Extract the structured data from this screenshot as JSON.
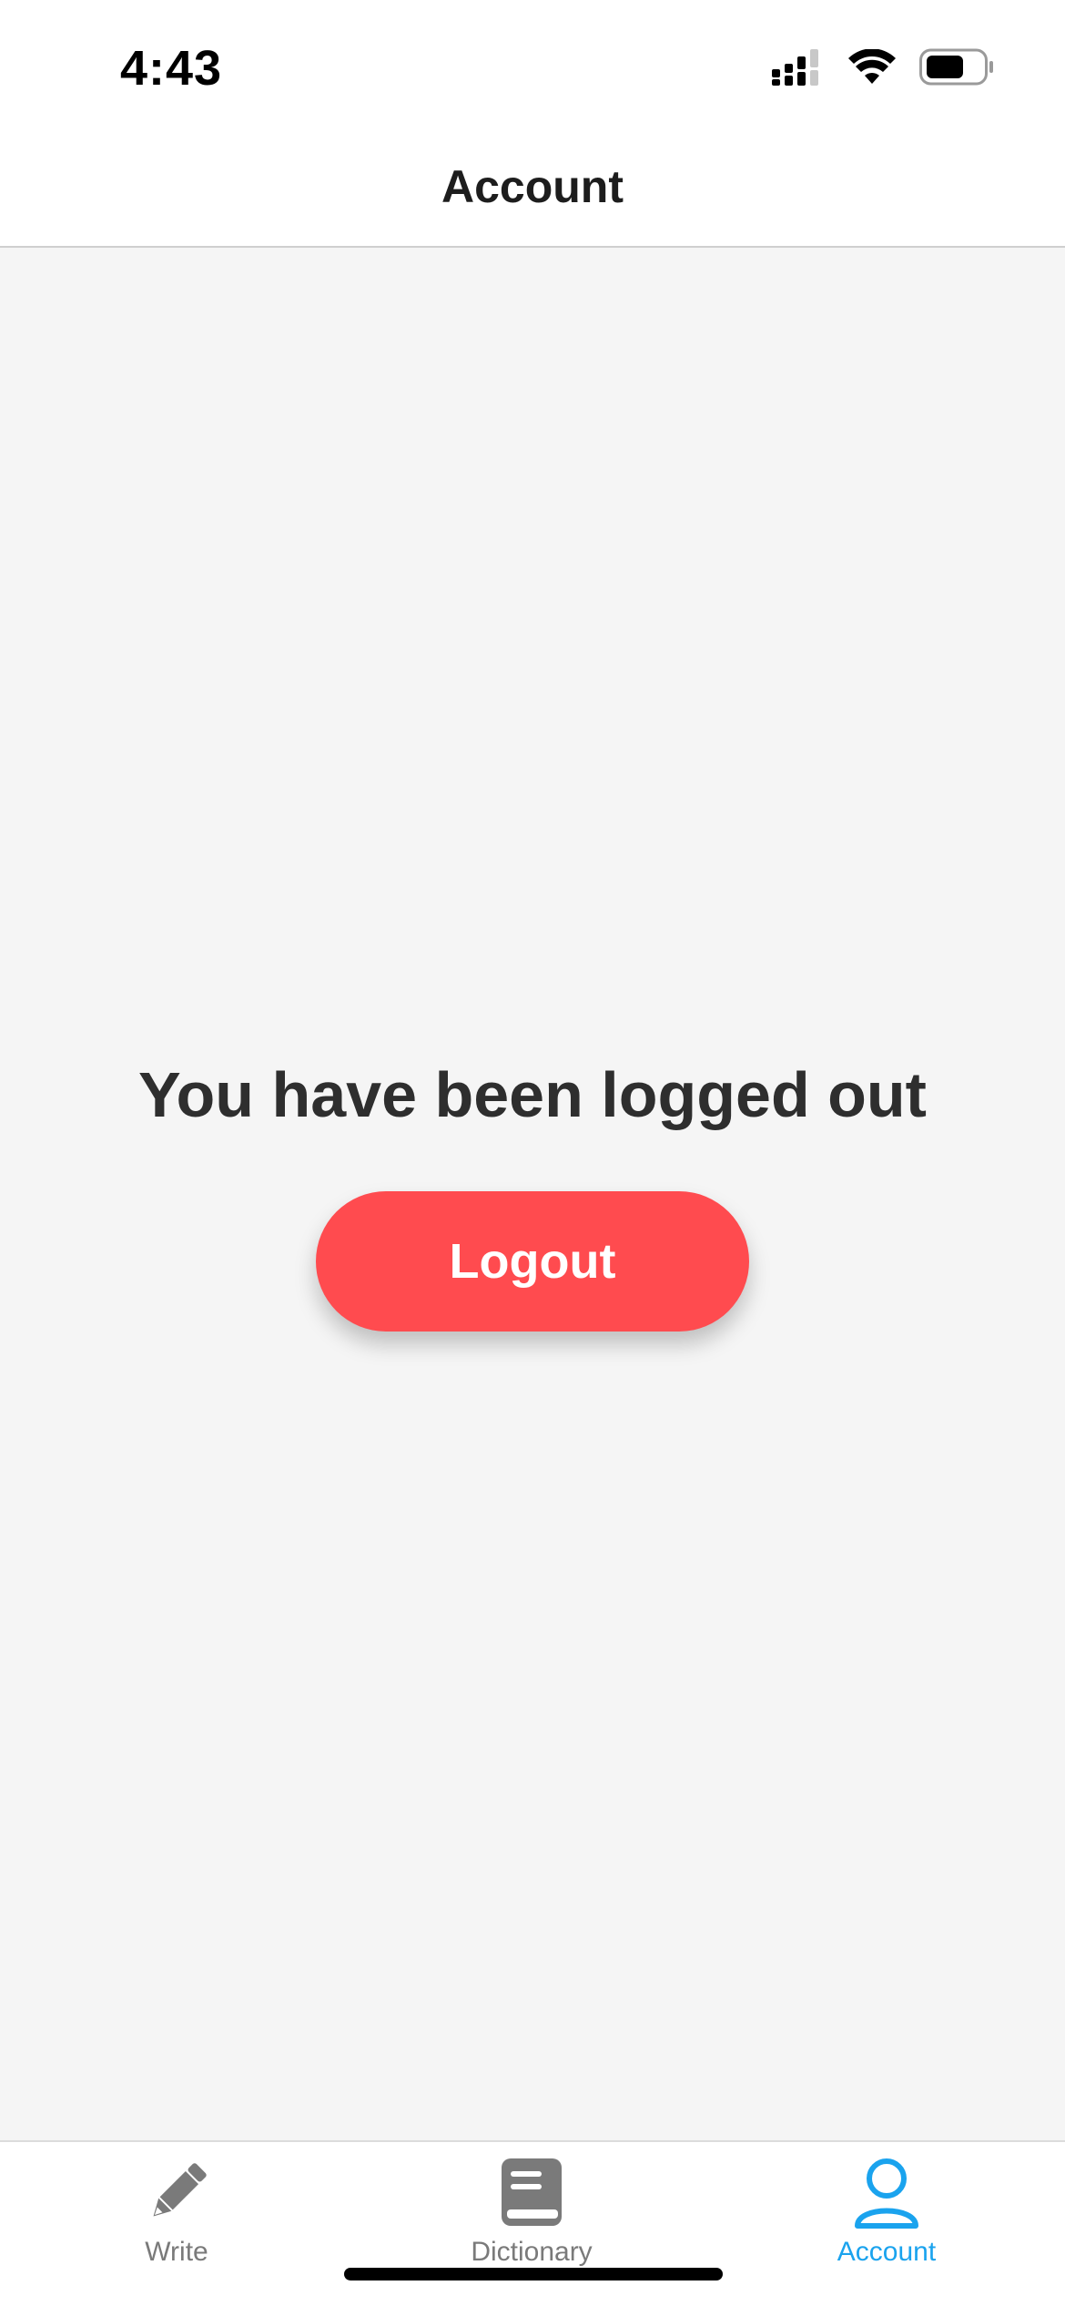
{
  "status_bar": {
    "time": "4:43"
  },
  "header": {
    "title": "Account"
  },
  "main": {
    "message": "You have been logged out",
    "logout_label": "Logout",
    "logout_color": "#ff4b4f"
  },
  "tab_bar": {
    "active_color": "#1aa3ee",
    "inactive_color": "#7a7a7a",
    "items": [
      {
        "label": "Write",
        "icon": "pencil-icon",
        "active": false
      },
      {
        "label": "Dictionary",
        "icon": "book-icon",
        "active": false
      },
      {
        "label": "Account",
        "icon": "user-icon",
        "active": true
      }
    ]
  }
}
